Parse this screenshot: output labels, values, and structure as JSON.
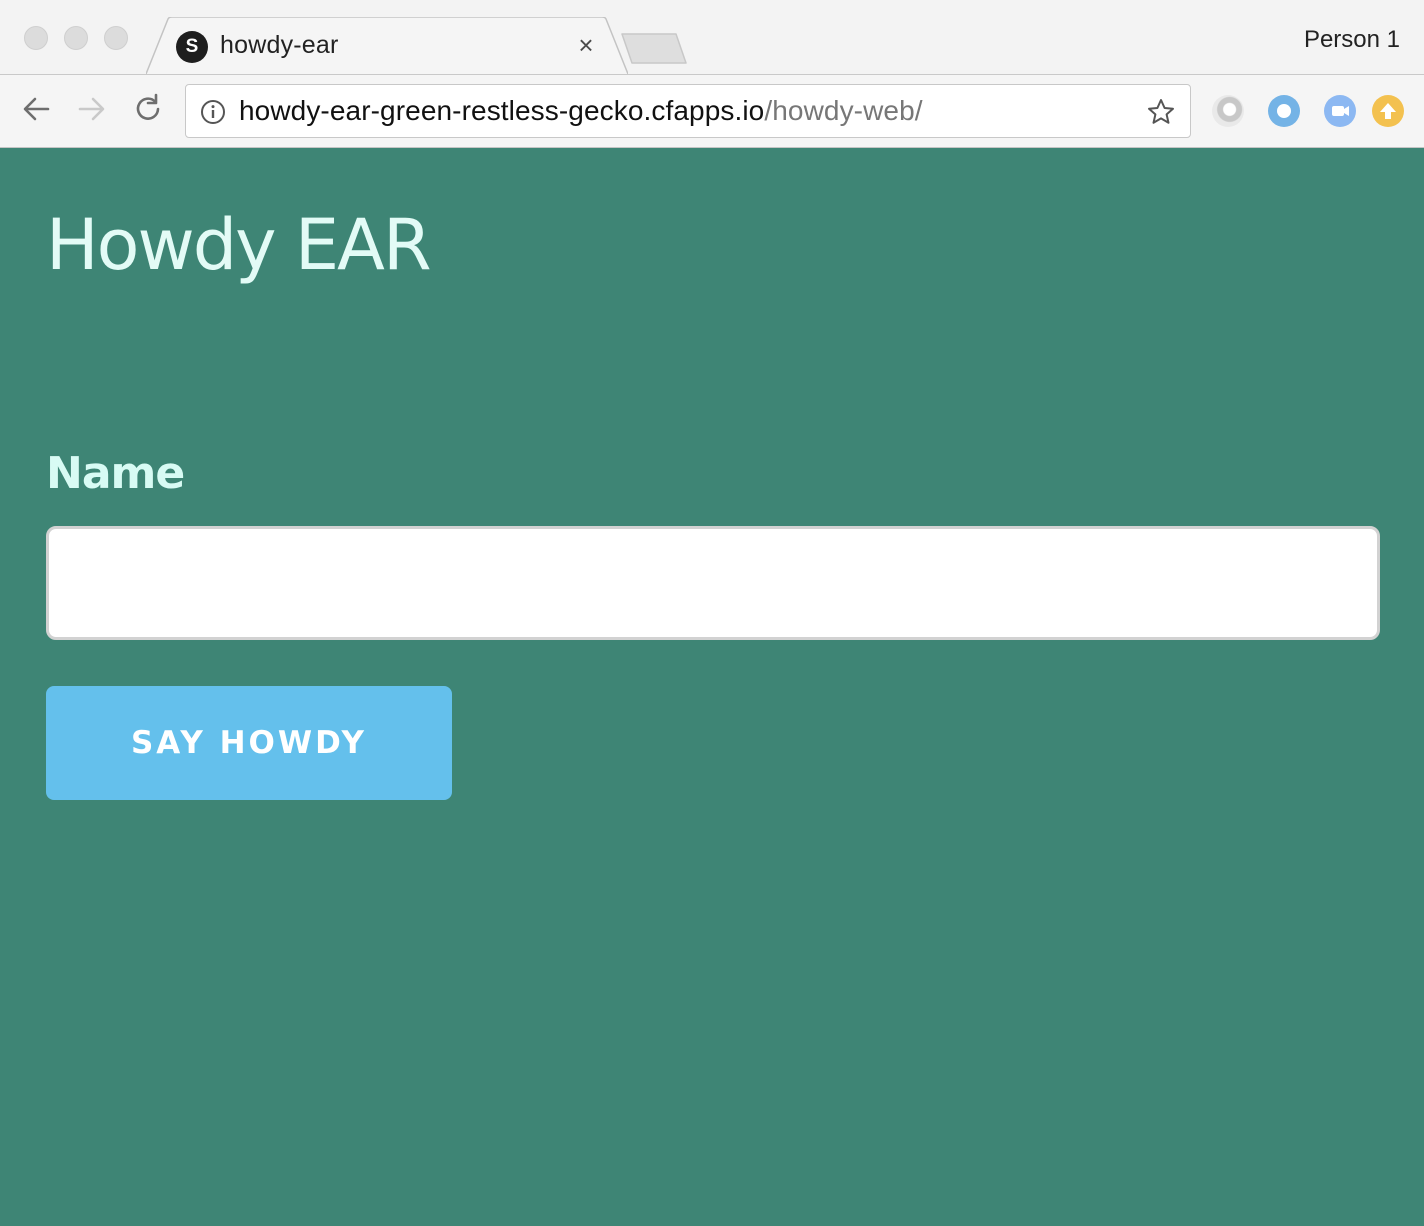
{
  "browser": {
    "tab": {
      "favicon_letter": "S",
      "title": "howdy-ear",
      "close_glyph": "×"
    },
    "profile_name": "Person 1",
    "url": {
      "host": "howdy-ear-green-restless-gecko.cfapps.io",
      "path": "/howdy-web/"
    },
    "extension_icons": [
      "extension-gray-icon",
      "extension-blue-ring-icon",
      "extension-video-icon",
      "extension-upload-icon"
    ]
  },
  "page": {
    "title": "Howdy EAR",
    "form": {
      "name_label": "Name",
      "name_value": "",
      "submit_label": "SAY HOWDY"
    }
  },
  "colors": {
    "page_background": "#3e8575",
    "heading_text": "#e3fbf6",
    "button_background": "#64c0ec",
    "button_text": "#ffffff"
  }
}
